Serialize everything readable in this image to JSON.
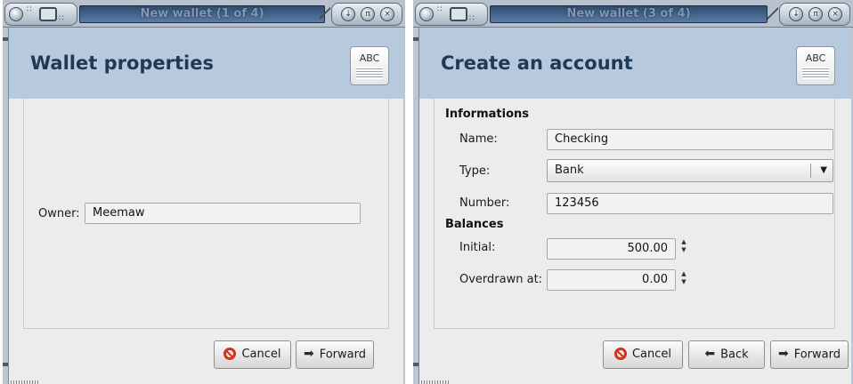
{
  "window1": {
    "title": "New wallet (1 of 4)",
    "page_title": "Wallet properties",
    "icon_text": "ABC",
    "owner_label": "Owner:",
    "owner_value": "Meemaw",
    "cancel_label": "Cancel",
    "forward_label": "Forward"
  },
  "window2": {
    "title": "New wallet (3 of 4)",
    "page_title": "Create an account",
    "icon_text": "ABC",
    "section_informations": "Informations",
    "name_label": "Name:",
    "name_value": "Checking",
    "type_label": "Type:",
    "type_value": "Bank",
    "number_label": "Number:",
    "number_value": "123456",
    "section_balances": "Balances",
    "initial_label": "Initial:",
    "initial_value": "500.00",
    "overdrawn_label": "Overdrawn at:",
    "overdrawn_value": "0.00",
    "cancel_label": "Cancel",
    "back_label": "Back",
    "forward_label": "Forward"
  }
}
